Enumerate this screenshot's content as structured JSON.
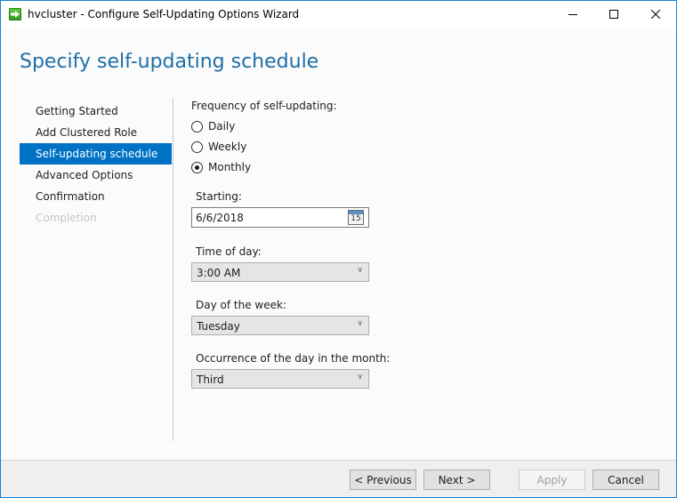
{
  "window": {
    "title": "hvcluster - Configure Self-Updating Options Wizard",
    "app_icon": "green-arrow-icon",
    "controls": {
      "minimize": "minimize-icon",
      "maximize": "maximize-icon",
      "close": "close-icon"
    }
  },
  "page": {
    "heading": "Specify self-updating schedule"
  },
  "nav": {
    "items": [
      {
        "label": "Getting Started",
        "state": "normal"
      },
      {
        "label": "Add Clustered Role",
        "state": "normal"
      },
      {
        "label": "Self-updating schedule",
        "state": "active"
      },
      {
        "label": "Advanced Options",
        "state": "normal"
      },
      {
        "label": "Confirmation",
        "state": "normal"
      },
      {
        "label": "Completion",
        "state": "disabled"
      }
    ]
  },
  "form": {
    "frequency": {
      "label": "Frequency of self-updating:",
      "options": [
        {
          "label": "Daily",
          "selected": false
        },
        {
          "label": "Weekly",
          "selected": false
        },
        {
          "label": "Monthly",
          "selected": true
        }
      ]
    },
    "starting": {
      "label": "Starting:",
      "value": "6/6/2018",
      "icon": "calendar-icon",
      "icon_text": "15"
    },
    "time_of_day": {
      "label": "Time of day:",
      "value": "3:00 AM"
    },
    "day_of_week": {
      "label": "Day of the week:",
      "value": "Tuesday"
    },
    "occurrence": {
      "label": "Occurrence of the day in the month:",
      "value": "Third"
    }
  },
  "footer": {
    "previous_label": "< Previous",
    "next_label": "Next >",
    "apply_label": "Apply",
    "apply_enabled": false,
    "cancel_label": "Cancel"
  },
  "colors": {
    "accent": "#0072c6",
    "heading": "#1e6fa8",
    "window_border": "#1883d7"
  }
}
